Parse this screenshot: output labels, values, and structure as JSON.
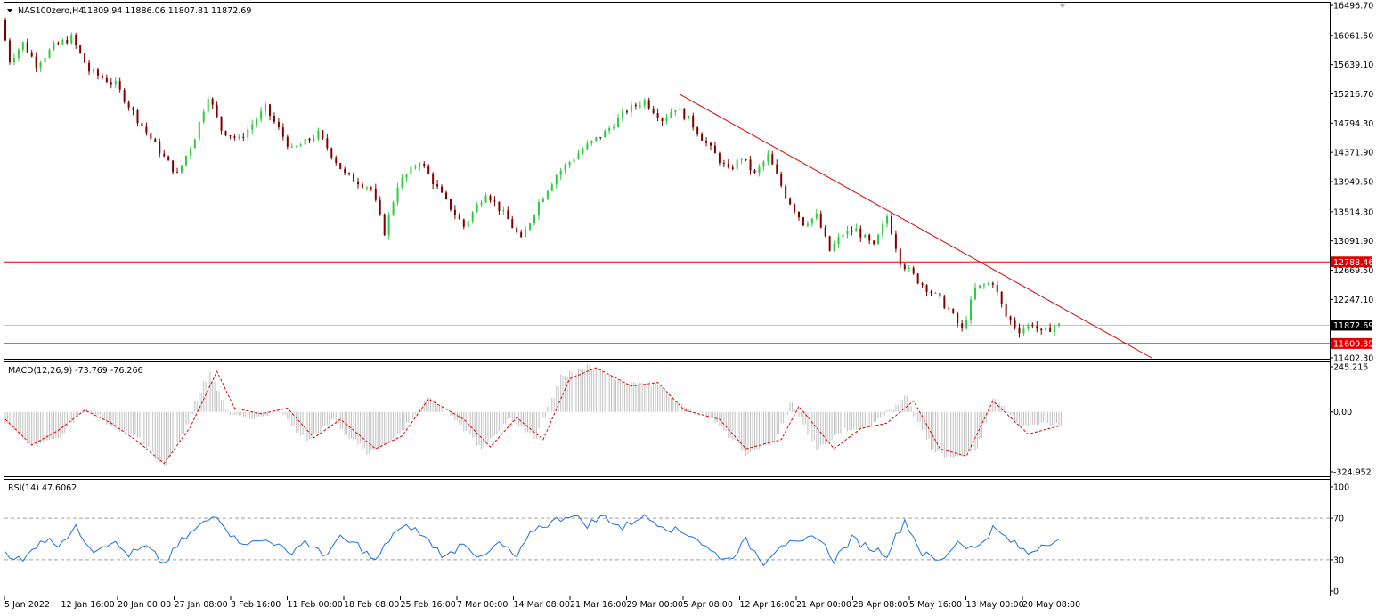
{
  "chart_data": [
    {
      "type": "candlestick",
      "pane": "main",
      "symbol_label": "NAS100zero,H4",
      "ohlc_label": "11809.94 11886.06 11807.81 11872.69",
      "y_ticks": [
        "16496.70",
        "16061.50",
        "15639.10",
        "15216.70",
        "14794.30",
        "14371.90",
        "13949.50",
        "13514.30",
        "13091.90",
        "12669.50",
        "12247.10",
        "11402.30"
      ],
      "ylim": [
        11402.3,
        16496.7
      ],
      "x_ticks": [
        "5 Jan 2022",
        "12 Jan 16:00",
        "20 Jan 00:00",
        "27 Jan 08:00",
        "3 Feb 16:00",
        "11 Feb 00:00",
        "18 Feb 08:00",
        "25 Feb 16:00",
        "7 Mar 00:00",
        "14 Mar 08:00",
        "21 Mar 16:00",
        "29 Mar 00:00",
        "5 Apr 08:00",
        "12 Apr 16:00",
        "21 Apr 00:00",
        "28 Apr 08:00",
        "5 May 16:00",
        "13 May 00:00",
        "20 May 08:00"
      ],
      "price_path": [
        [
          0,
          16280
        ],
        [
          2,
          15700
        ],
        [
          5,
          15950
        ],
        [
          8,
          15650
        ],
        [
          12,
          15900
        ],
        [
          16,
          16030
        ],
        [
          20,
          15550
        ],
        [
          26,
          15350
        ],
        [
          32,
          14750
        ],
        [
          37,
          14300
        ],
        [
          40,
          14050
        ],
        [
          44,
          14600
        ],
        [
          47,
          15200
        ],
        [
          50,
          14700
        ],
        [
          54,
          14550
        ],
        [
          60,
          15010
        ],
        [
          66,
          14400
        ],
        [
          72,
          14640
        ],
        [
          78,
          14050
        ],
        [
          84,
          13850
        ],
        [
          87,
          13220
        ],
        [
          90,
          13900
        ],
        [
          95,
          14250
        ],
        [
          100,
          13750
        ],
        [
          105,
          13300
        ],
        [
          110,
          13800
        ],
        [
          115,
          13400
        ],
        [
          118,
          13100
        ],
        [
          122,
          13650
        ],
        [
          126,
          14050
        ],
        [
          132,
          14420
        ],
        [
          137,
          14660
        ],
        [
          142,
          14980
        ],
        [
          146,
          15120
        ],
        [
          150,
          14850
        ],
        [
          153,
          15020
        ],
        [
          156,
          14850
        ],
        [
          160,
          14500
        ],
        [
          165,
          14100
        ],
        [
          168,
          14300
        ],
        [
          171,
          14050
        ],
        [
          174,
          14320
        ],
        [
          178,
          13750
        ],
        [
          182,
          13350
        ],
        [
          185,
          13450
        ],
        [
          188,
          12950
        ],
        [
          191,
          13200
        ],
        [
          194,
          13250
        ],
        [
          198,
          13000
        ],
        [
          201,
          13450
        ],
        [
          204,
          12800
        ],
        [
          208,
          12520
        ],
        [
          212,
          12300
        ],
        [
          215,
          12100
        ],
        [
          218,
          11800
        ],
        [
          221,
          12400
        ],
        [
          225,
          12500
        ],
        [
          228,
          12000
        ],
        [
          231,
          11800
        ],
        [
          234,
          11900
        ],
        [
          236,
          11750
        ],
        [
          239,
          11870
        ]
      ],
      "support_resistance_lines": [
        12788.46,
        11609.39
      ],
      "current_price_line": 11872.69,
      "current_price_label": "11872.69",
      "price_tags": [
        {
          "value": 12788.46,
          "label": "12788.46"
        },
        {
          "value": 11609.39,
          "label": "11609.39"
        }
      ],
      "trendline": {
        "from": [
          153,
          15210
        ],
        "to": [
          260,
          11402.3
        ]
      },
      "colors": {
        "bull": "#2ecc40",
        "bear": "#800000",
        "levels": "#e00000",
        "current": "#c0c0c0",
        "tag_level_bg": "#e00000",
        "tag_current_bg": "#000000"
      }
    },
    {
      "type": "bar",
      "pane": "macd",
      "label": "MACD(12,26,9) -73.769 -76.266",
      "y_ticks": [
        "245.215",
        "0.00",
        "-324.952"
      ],
      "ylim": [
        -324.952,
        245.215
      ],
      "histogram_path": [
        [
          0,
          -60
        ],
        [
          6,
          -180
        ],
        [
          12,
          -140
        ],
        [
          18,
          30
        ],
        [
          24,
          -80
        ],
        [
          30,
          -150
        ],
        [
          36,
          -300
        ],
        [
          40,
          -120
        ],
        [
          46,
          230
        ],
        [
          50,
          0
        ],
        [
          56,
          -40
        ],
        [
          62,
          10
        ],
        [
          68,
          -160
        ],
        [
          74,
          -50
        ],
        [
          82,
          -230
        ],
        [
          88,
          -150
        ],
        [
          96,
          80
        ],
        [
          102,
          -50
        ],
        [
          108,
          -200
        ],
        [
          114,
          -40
        ],
        [
          120,
          -140
        ],
        [
          126,
          200
        ],
        [
          132,
          250
        ],
        [
          140,
          160
        ],
        [
          148,
          150
        ],
        [
          154,
          20
        ],
        [
          160,
          -40
        ],
        [
          168,
          -230
        ],
        [
          174,
          -170
        ],
        [
          178,
          50
        ],
        [
          184,
          -200
        ],
        [
          190,
          -100
        ],
        [
          196,
          -80
        ],
        [
          204,
          80
        ],
        [
          210,
          -200
        ],
        [
          214,
          -260
        ],
        [
          220,
          -210
        ],
        [
          224,
          80
        ],
        [
          230,
          -80
        ],
        [
          236,
          -60
        ],
        [
          239,
          -73
        ]
      ],
      "signal_path": [
        [
          0,
          -40
        ],
        [
          6,
          -180
        ],
        [
          12,
          -100
        ],
        [
          18,
          10
        ],
        [
          24,
          -60
        ],
        [
          30,
          -160
        ],
        [
          36,
          -280
        ],
        [
          42,
          -80
        ],
        [
          48,
          220
        ],
        [
          52,
          20
        ],
        [
          58,
          -10
        ],
        [
          64,
          20
        ],
        [
          70,
          -140
        ],
        [
          76,
          -40
        ],
        [
          84,
          -200
        ],
        [
          90,
          -130
        ],
        [
          96,
          70
        ],
        [
          104,
          -40
        ],
        [
          110,
          -190
        ],
        [
          116,
          -30
        ],
        [
          122,
          -150
        ],
        [
          128,
          180
        ],
        [
          134,
          240
        ],
        [
          142,
          140
        ],
        [
          148,
          160
        ],
        [
          154,
          10
        ],
        [
          162,
          -40
        ],
        [
          168,
          -200
        ],
        [
          176,
          -150
        ],
        [
          180,
          30
        ],
        [
          188,
          -200
        ],
        [
          194,
          -90
        ],
        [
          200,
          -60
        ],
        [
          206,
          60
        ],
        [
          212,
          -200
        ],
        [
          218,
          -240
        ],
        [
          224,
          60
        ],
        [
          232,
          -120
        ],
        [
          239,
          -76
        ]
      ],
      "colors": {
        "histogram": "#c0c0c0",
        "signal": "#e00000"
      }
    },
    {
      "type": "line",
      "pane": "rsi",
      "label": "RSI(14) 47.6062",
      "y_ticks": [
        "100",
        "70",
        "30",
        "0"
      ],
      "ylim": [
        0,
        100
      ],
      "levels": [
        70,
        30
      ],
      "series": [
        {
          "values": [
            [
              0,
              38
            ],
            [
              4,
              28
            ],
            [
              8,
              50
            ],
            [
              12,
              46
            ],
            [
              16,
              60
            ],
            [
              20,
              40
            ],
            [
              24,
              48
            ],
            [
              28,
              35
            ],
            [
              32,
              42
            ],
            [
              36,
              26
            ],
            [
              40,
              48
            ],
            [
              44,
              62
            ],
            [
              48,
              74
            ],
            [
              52,
              50
            ],
            [
              56,
              46
            ],
            [
              60,
              50
            ],
            [
              64,
              36
            ],
            [
              68,
              48
            ],
            [
              72,
              34
            ],
            [
              76,
              50
            ],
            [
              80,
              44
            ],
            [
              84,
              28
            ],
            [
              88,
              56
            ],
            [
              92,
              62
            ],
            [
              96,
              48
            ],
            [
              100,
              32
            ],
            [
              104,
              48
            ],
            [
              108,
              30
            ],
            [
              112,
              46
            ],
            [
              116,
              32
            ],
            [
              120,
              60
            ],
            [
              124,
              66
            ],
            [
              128,
              74
            ],
            [
              132,
              64
            ],
            [
              136,
              72
            ],
            [
              140,
              60
            ],
            [
              144,
              72
            ],
            [
              148,
              66
            ],
            [
              152,
              58
            ],
            [
              156,
              54
            ],
            [
              160,
              38
            ],
            [
              164,
              30
            ],
            [
              168,
              48
            ],
            [
              172,
              28
            ],
            [
              176,
              46
            ],
            [
              180,
              44
            ],
            [
              184,
              54
            ],
            [
              188,
              30
            ],
            [
              192,
              50
            ],
            [
              196,
              42
            ],
            [
              200,
              36
            ],
            [
              204,
              68
            ],
            [
              208,
              36
            ],
            [
              212,
              28
            ],
            [
              216,
              48
            ],
            [
              220,
              40
            ],
            [
              224,
              60
            ],
            [
              228,
              48
            ],
            [
              232,
              36
            ],
            [
              236,
              47.6
            ]
          ]
        }
      ],
      "colors": {
        "line": "#1e70e6",
        "levels": "#a0a0a0"
      }
    }
  ]
}
